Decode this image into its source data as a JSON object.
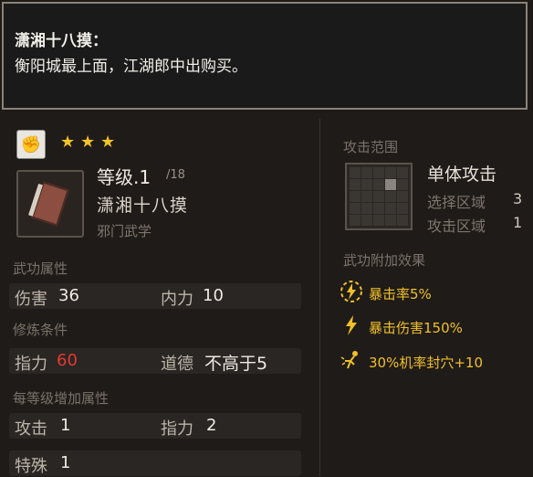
{
  "tooltip": {
    "title": "潇湘十八摸：",
    "desc": "衡阳城最上面，江湖郎中出购买。"
  },
  "header": {
    "stars": 3,
    "level_label": "等级.1",
    "level_max": "/18",
    "skill_name": "潇湘十八摸",
    "category": "邪门武学"
  },
  "martial_attrs": {
    "title": "武功属性",
    "row1": {
      "l1": "伤害",
      "v1": "36",
      "l2": "内力",
      "v2": "10"
    }
  },
  "requirements": {
    "title": "修炼条件",
    "row1": {
      "l1": "指力",
      "v1": "60",
      "l2": "道德",
      "v2": "不高于5"
    }
  },
  "per_level": {
    "title": "每等级增加属性",
    "row1": {
      "l1": "攻击",
      "v1": "1",
      "l2": "指力",
      "v2": "2"
    },
    "row2": {
      "l1": "特殊",
      "v1": "1"
    }
  },
  "attack_range": {
    "title": "攻击范围",
    "type": "单体攻击",
    "select_label": "选择区域",
    "select_val": "3",
    "attack_label": "攻击区域",
    "attack_val": "1"
  },
  "effects": {
    "title": "武功附加效果",
    "items": [
      {
        "icon": "lightning-circle-icon",
        "text": "暴击率5%"
      },
      {
        "icon": "lightning-icon",
        "text": "暴击伤害150%"
      },
      {
        "icon": "acupoint-icon",
        "text": "30%机率封穴+10"
      }
    ]
  },
  "colors": {
    "gold": "#f0c02a",
    "red": "#e23a32"
  }
}
